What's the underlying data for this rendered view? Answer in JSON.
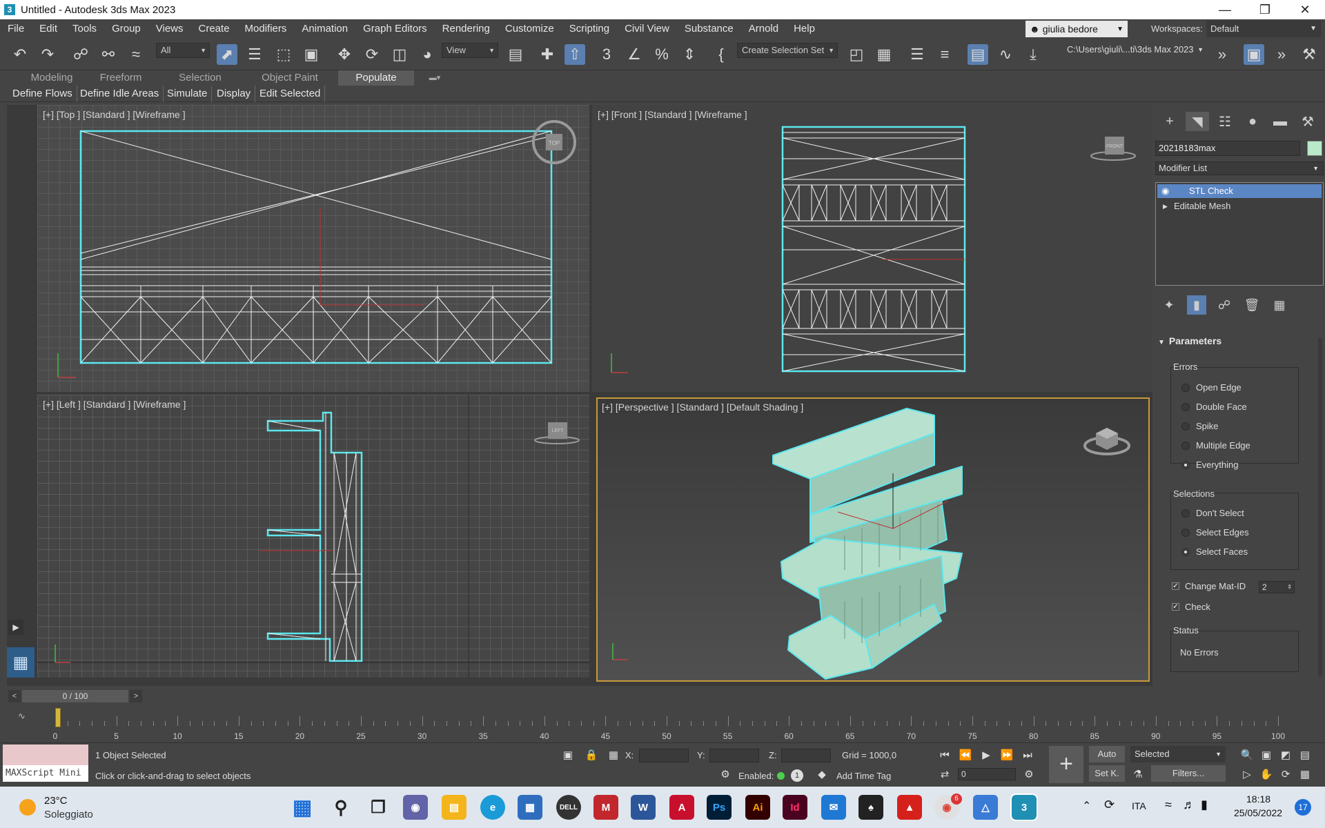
{
  "window": {
    "title": "Untitled - Autodesk 3ds Max 2023",
    "app_icon": "3"
  },
  "menu": [
    "File",
    "Edit",
    "Tools",
    "Group",
    "Views",
    "Create",
    "Modifiers",
    "Animation",
    "Graph Editors",
    "Rendering",
    "Customize",
    "Scripting",
    "Civil View",
    "Substance",
    "Arnold",
    "Help"
  ],
  "user": {
    "name": "giulia bedore"
  },
  "workspace": {
    "label": "Workspaces:",
    "value": "Default"
  },
  "toolbar": {
    "filter": "All",
    "ref_coord": "View",
    "selection_set": "Create Selection Set",
    "project_path": "C:\\Users\\giuli\\...ti\\3ds Max 2023"
  },
  "ribbon": {
    "tabs": [
      "Modeling",
      "Freeform",
      "Selection",
      "Object Paint",
      "Populate"
    ],
    "active_tab": "Populate",
    "commands": [
      "Define Flows",
      "Define Idle Areas",
      "Simulate",
      "Display",
      "Edit Selected"
    ]
  },
  "viewports": {
    "top": "[+] [Top ] [Standard ] [Wireframe ]",
    "front": "[+] [Front ] [Standard ] [Wireframe ]",
    "left": "[+] [Left ] [Standard ] [Wireframe ]",
    "perspective": "[+] [Perspective ] [Standard ] [Default Shading ]",
    "cube_top": "TOP",
    "cube_front": "FRONT",
    "cube_left": "LEFT"
  },
  "command_panel": {
    "object_name": "20218183max",
    "object_color": "#b9e9c9",
    "modifier_list": "Modifier List",
    "stack": [
      "STL Check",
      "Editable Mesh"
    ],
    "parameters_title": "Parameters",
    "errors_title": "Errors",
    "errors": [
      "Open Edge",
      "Double Face",
      "Spike",
      "Multiple Edge",
      "Everything"
    ],
    "errors_selected": "Everything",
    "selections_title": "Selections",
    "selections": [
      "Don't Select",
      "Select Edges",
      "Select Faces"
    ],
    "selections_selected": "Select Faces",
    "change_mat_id": "Change Mat-ID",
    "mat_id_value": "2",
    "check_label": "Check",
    "status_title": "Status",
    "status_value": "No Errors"
  },
  "timeline": {
    "frame": "0 / 100",
    "ticks": [
      "0",
      "5",
      "10",
      "15",
      "20",
      "25",
      "30",
      "35",
      "40",
      "45",
      "50",
      "55",
      "60",
      "65",
      "70",
      "75",
      "80",
      "85",
      "90",
      "95",
      "100"
    ]
  },
  "status": {
    "maxscript": "MAXScript Mini",
    "objects_selected": "1 Object Selected",
    "prompt": "Click or click-and-drag to select objects",
    "x_label": "X:",
    "y_label": "Y:",
    "z_label": "Z:",
    "grid": "Grid = 1000,0",
    "enabled": "Enabled:",
    "enabled_count": "1",
    "add_time_tag": "Add Time Tag",
    "frame_value": "0",
    "auto": "Auto",
    "set_key": "Set K.",
    "selected": "Selected",
    "filters": "Filters..."
  },
  "taskbar": {
    "weather_temp": "23°C",
    "weather_desc": "Soleggiato",
    "lang": "ITA",
    "time": "18:18",
    "date": "25/05/2022",
    "notifications": "17",
    "chrome_badge": "6"
  }
}
